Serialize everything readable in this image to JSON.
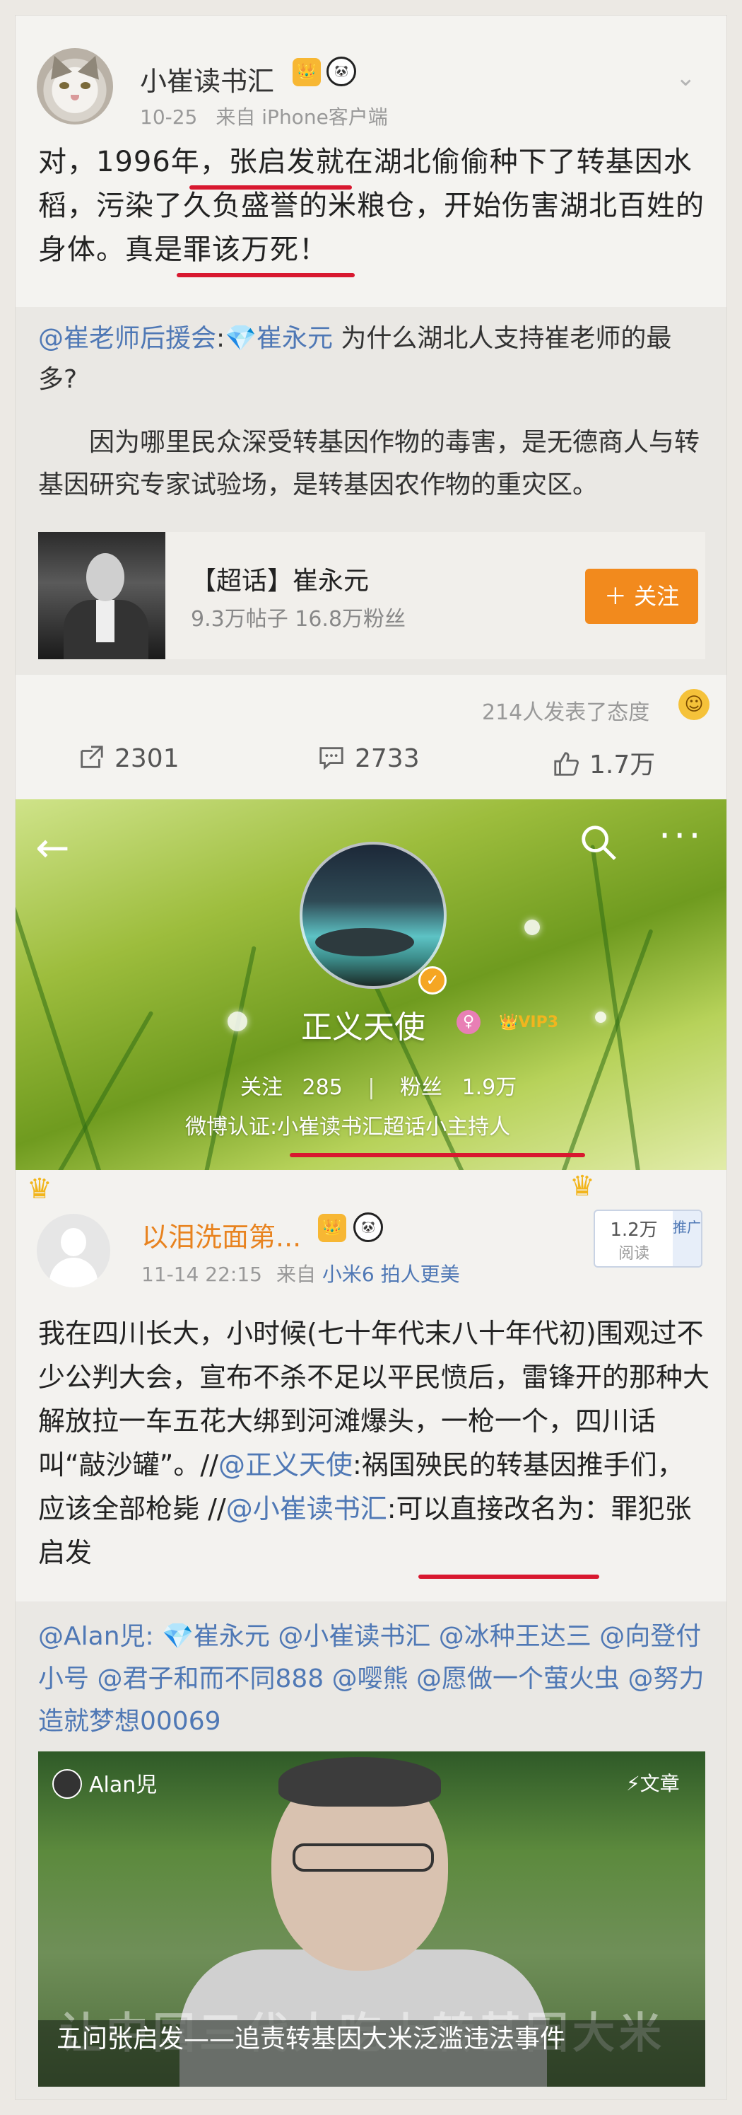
{
  "post1": {
    "user_name": "小崔读书汇",
    "crown_badge": "👑",
    "panda_badge": "🐼",
    "date": "10-25",
    "source": "来自 iPhone客户端",
    "text": "对，1996年，张启发就在湖北偷偷种下了转基因水稻，污染了久负盛誉的米粮仓，开始伤害湖北百姓的身体。真是罪该万死！",
    "repost": {
      "author": "@崔老师后援会",
      "sep": ":",
      "topic": "💎崔永元",
      "question": " 为什么湖北人支持崔老师的最多?",
      "body": "因为哪里民众深受转基因作物的毒害，是无德商人与转基因研究专家试验场，是转基因农作物的重灾区。"
    },
    "card": {
      "title": "【超话】崔永元",
      "sub": "9.3万帖子 16.8万粉丝",
      "follow": "＋ 关注"
    },
    "attitude": "214人发表了态度",
    "actions": {
      "repost": "2301",
      "comment": "2733",
      "like": "1.7万"
    }
  },
  "profile": {
    "name": "正义天使",
    "vip": "VIP3",
    "follow_label": "关注",
    "follow_count": "285",
    "fans_label": "粉丝",
    "fans_count": "1.9万",
    "verify": "微博认证:小崔读书汇超话小主持人"
  },
  "post2": {
    "user_name": "以泪洗面第...",
    "date": "11-14 22:15",
    "source_prefix": "来自",
    "source_phone": "小米6 拍人更美",
    "read_count": "1.2万",
    "read_label": "阅读",
    "ad_label": "推广",
    "text_a": "我在四川长大，小时候(七十年代末八十年代初)围观过不少公判大会，宣布不杀不足以平民愤后，雷锋开的那种大解放拉一车五花大绑到河滩爆头，一枪一个，四川话叫“敲沙罐”。//",
    "mention_a": "@正义天使",
    "text_b": ":祸国殃民的转基因推手们，应该全部枪毙 //",
    "mention_b": "@小崔读书汇",
    "text_c": ":可以直接改名为：罪犯张启发",
    "mentions": "@Alan児: 💎崔永元 @小崔读书汇 @冰种王达三 @向登付小号 @君子和而不同888 @嘤熊 @愿做一个萤火虫 @努力造就梦想00069",
    "article": {
      "user": "Alan児",
      "tag": "⚡文章",
      "bigtext": "让中国三代人吃上转基因大米",
      "title": "五问张启发——追责转基因大米泛滥违法事件"
    }
  },
  "colors": {
    "highlight_red": "#d8182f",
    "link_blue": "#4f78b5",
    "follow_orange": "#f28a1d"
  }
}
